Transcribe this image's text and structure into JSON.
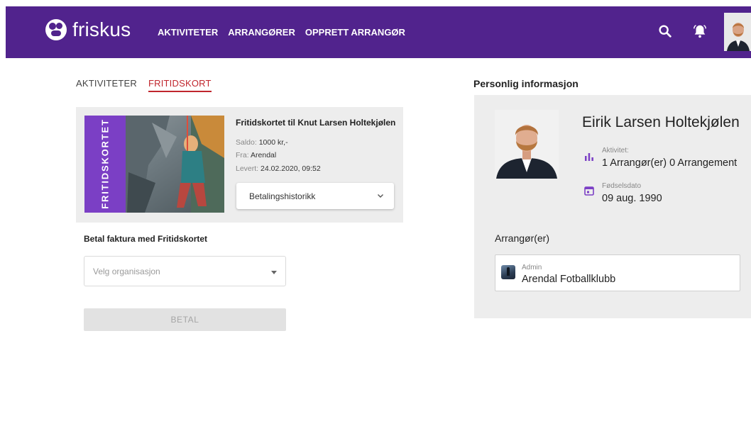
{
  "header": {
    "logo_text": "friskus",
    "nav": [
      "AKTIVITETER",
      "ARRANGØRER",
      "OPPRETT ARRANGØR"
    ],
    "icons": [
      "search-icon",
      "bell-icon"
    ],
    "brand_color": "#51238d"
  },
  "tabs": [
    "AKTIVITETER",
    "FRITIDSKORT"
  ],
  "active_tab": "FRITIDSKORT",
  "card": {
    "ribbon_text": "FRITIDSKORTET",
    "title": "Fritidskortet til Knut Larsen Holtekjølen",
    "saldo_label": "Saldo:",
    "saldo_value": "1000 kr,-",
    "fra_label": "Fra:",
    "fra_value": "Arendal",
    "levert_label": "Levert:",
    "levert_value": "24.02.2020, 09:52",
    "payment_history": "Betalingshistorikk"
  },
  "pay": {
    "section_title": "Betal faktura med Fritidskortet",
    "select_placeholder": "Velg organisasjon",
    "button": "BETAL"
  },
  "profile": {
    "section_title": "Personlig informasjon",
    "name": "Eirik Larsen Holtekjølen",
    "activity_label": "Aktivitet:",
    "activity_value": "1 Arrangør(er) 0 Arrangement",
    "birth_label": "Fødselsdato",
    "birth_value": "09 aug. 1990",
    "organizers_title": "Arrangør(er)",
    "organizer_role": "Admin",
    "organizer_name": "Arendal Fotballklubb",
    "accent_color": "#7b3fc5"
  }
}
